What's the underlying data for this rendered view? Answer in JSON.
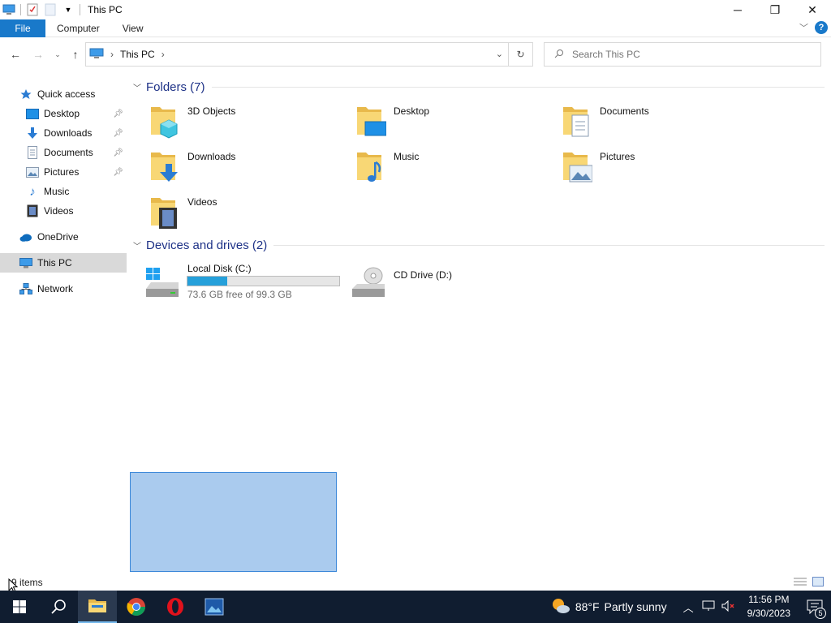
{
  "window": {
    "title": "This PC",
    "controls": {
      "minimize": "─",
      "maximize": "❐",
      "close": "✕"
    }
  },
  "ribbon": {
    "tabs": [
      "File",
      "Computer",
      "View"
    ],
    "help": "?"
  },
  "address": {
    "location": "This PC",
    "search_placeholder": "Search This PC"
  },
  "nav": {
    "quick_access": "Quick access",
    "quick_items": [
      {
        "label": "Desktop",
        "icon": "desktop-icon",
        "pinned": true
      },
      {
        "label": "Downloads",
        "icon": "downloads-icon",
        "pinned": true
      },
      {
        "label": "Documents",
        "icon": "documents-icon",
        "pinned": true
      },
      {
        "label": "Pictures",
        "icon": "pictures-icon",
        "pinned": true
      },
      {
        "label": "Music",
        "icon": "music-icon",
        "pinned": false
      },
      {
        "label": "Videos",
        "icon": "videos-icon",
        "pinned": false
      }
    ],
    "onedrive": "OneDrive",
    "thispc": "This PC",
    "network": "Network"
  },
  "folders": {
    "header": "Folders (7)",
    "items": [
      "3D Objects",
      "Desktop",
      "Documents",
      "Downloads",
      "Music",
      "Pictures",
      "Videos"
    ]
  },
  "drives": {
    "header": "Devices and drives (2)",
    "items": [
      {
        "label": "Local Disk (C:)",
        "free_text": "73.6 GB free of 99.3 GB",
        "used_fraction": 0.26
      },
      {
        "label": "CD Drive (D:)"
      }
    ]
  },
  "status": {
    "count": "9 items"
  },
  "taskbar": {
    "weather": {
      "temp": "88°F",
      "condition": "Partly sunny"
    },
    "time": "11:56 PM",
    "date": "9/30/2023",
    "notifications": "5"
  },
  "colors": {
    "accent": "#1979ca",
    "taskbar": "#101d30",
    "selection": "#aacbee",
    "disk_fill": "#26a0da"
  }
}
